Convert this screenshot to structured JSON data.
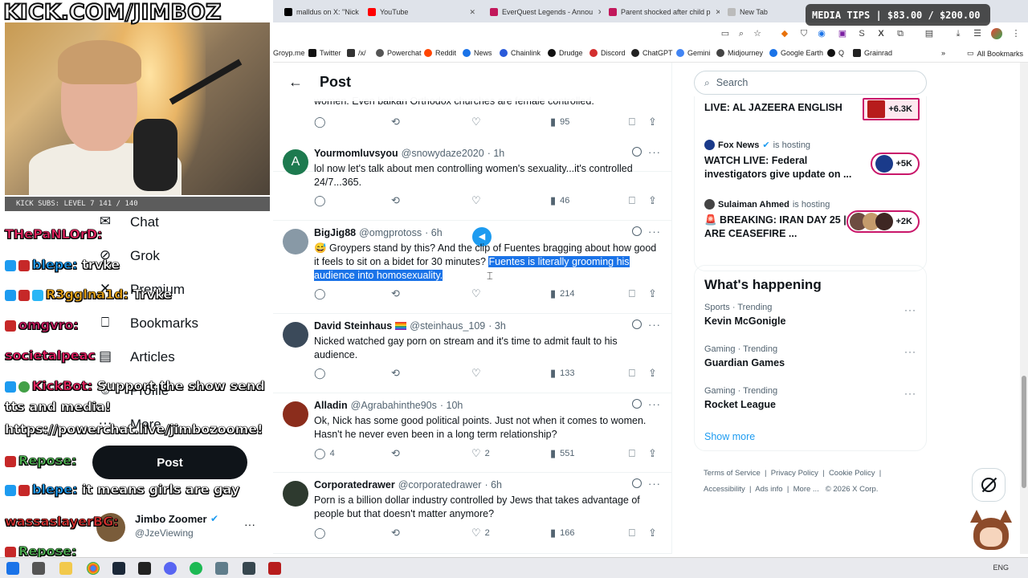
{
  "browser": {
    "tabs": [
      {
        "label": "malldus on X: \"Nick",
        "color": "#000000"
      },
      {
        "label": "YouTube",
        "color": "#ff0000"
      },
      {
        "label": "EverQuest Legends - Annou",
        "color": "#c2185b"
      },
      {
        "label": "Parent shocked after child p",
        "color": "#c2185b"
      },
      {
        "label": "New Tab",
        "color": "#5f6368"
      }
    ],
    "bookmarks": [
      "Groyp.me",
      "Twitter",
      "/x/",
      "Powerchat",
      "Reddit",
      "News",
      "Chainlink",
      "Drudge",
      "Discord",
      "ChatGPT",
      "Gemini",
      "Midjourney",
      "Google Earth",
      "Q",
      "Grainrad"
    ],
    "all_bookmarks": "All Bookmarks"
  },
  "stream": {
    "title": "KICK.COM/JIMBOZ",
    "subs_bar": "KICK SUBS: LEVEL 7 141 / 140",
    "media_tips": "MEDIA TIPS | $83.00 / $200.00"
  },
  "chat": [
    {
      "user": "THePaNLOrD:",
      "msg": "",
      "color": "#e0245e"
    },
    {
      "user": "blepe:",
      "msg": "trvke",
      "color": "#1d9bf0"
    },
    {
      "user": "R3gglna1d:",
      "msg": "Trvke",
      "color": "#e8a317"
    },
    {
      "user": "omgvro:",
      "msg": "",
      "color": "#c2185b"
    },
    {
      "user": "societalpeac",
      "msg": "",
      "color": "#e91e63"
    },
    {
      "user": "KickBot:",
      "msg": "Support the show send",
      "color": "#e0245e"
    },
    {
      "user": "",
      "msg": "tts and media!",
      "color": "#ffffff"
    },
    {
      "user": "",
      "msg": "https://powerchat.live/jimbozoome!",
      "color": "#ffffff"
    },
    {
      "user": "Repose:",
      "msg": "",
      "color": "#4caf50"
    },
    {
      "user": "blepe:",
      "msg": "it means girls are gay",
      "color": "#1d9bf0"
    },
    {
      "user": "wassaslayerBG:",
      "msg": "",
      "color": "#d32f2f"
    },
    {
      "user": "Repose:",
      "msg": "",
      "color": "#4caf50"
    }
  ],
  "nav": {
    "items": [
      "Chat",
      "Grok",
      "Premium",
      "Bookmarks",
      "Articles",
      "Profile",
      "More"
    ],
    "post_button": "Post",
    "account_name": "Jimbo Zoomer",
    "account_handle": "@JzeViewing"
  },
  "main": {
    "header_title": "Post",
    "top_snippet": "women. Even balkan Orthodox churches are female controlled.",
    "top_views": "95",
    "tweets": [
      {
        "name": "Yourmomluvsyou",
        "handle": "@snowydaze2020",
        "time": "· 1h",
        "text": "lol now let's talk about men controlling women's sexuality...it's controlled 24/7...365.",
        "replies": "",
        "likes": "",
        "views": "46",
        "avatar_color": "#1d7a4f",
        "avatar_letter": "A"
      },
      {
        "name": "BigJig88",
        "handle": "@omgprotoss",
        "time": "· 6h",
        "text_pre": "😅 Groypers stand by this? And the clip of Fuentes bragging about how good it feels to sit on a bidet for 30 minutes? ",
        "text_hl": "Fuentes is literally grooming his audience into homosexuality.",
        "replies": "",
        "likes": "",
        "views": "214",
        "avatar_color": "#8899a6",
        "avatar_letter": ""
      },
      {
        "name": "David Steinhaus",
        "handle": "@steinhaus_109",
        "time": "· 3h",
        "text": "Nicked watched gay porn on stream and it's time to admit fault to his audience.",
        "replies": "",
        "likes": "",
        "views": "133",
        "avatar_color": "#3b4a5a",
        "avatar_letter": ""
      },
      {
        "name": "Alladin",
        "handle": "@Agrabahinthe90s",
        "time": "· 10h",
        "text": "Ok, Nick has some good political points. Just not when it comes to women. Hasn't he never even been in a long term relationship?",
        "replies": "4",
        "likes": "2",
        "views": "551",
        "avatar_color": "#8b2d1c",
        "avatar_letter": ""
      },
      {
        "name": "Corporatedrawer",
        "handle": "@corporatedrawer",
        "time": "· 6h",
        "text": "Porn is a billion dollar industry controlled by Jews that takes advantage of people but that doesn't matter anymore?",
        "replies": "",
        "likes": "2",
        "views": "166",
        "avatar_color": "#2e3a2f",
        "avatar_letter": ""
      }
    ]
  },
  "sidebar": {
    "search_placeholder": "Search",
    "live": [
      {
        "host": "",
        "suffix": "",
        "title": "LIVE: AL JAZEERA ENGLISH",
        "count": "+6.3K"
      },
      {
        "host": "Fox News",
        "suffix": "is hosting",
        "title": "WATCH LIVE: Federal investigators give update on ...",
        "count": "+5K"
      },
      {
        "host": "Sulaiman Ahmed",
        "suffix": "is hosting",
        "title": "🚨 BREAKING: IRAN DAY 25 | ARE CEASEFIRE ...",
        "count": "+2K"
      }
    ],
    "happening_title": "What's happening",
    "trends": [
      {
        "category": "Sports · Trending",
        "title": "Kevin McGonigle"
      },
      {
        "category": "Gaming · Trending",
        "title": "Guardian Games"
      },
      {
        "category": "Gaming · Trending",
        "title": "Rocket League"
      }
    ],
    "show_more": "Show more",
    "footer": {
      "terms": "Terms of Service",
      "privacy": "Privacy Policy",
      "cookie": "Cookie Policy",
      "accessibility": "Accessibility",
      "ads": "Ads info",
      "more": "More ...",
      "copyright": "© 2026 X Corp."
    }
  },
  "taskbar": {
    "lang": "ENG"
  }
}
